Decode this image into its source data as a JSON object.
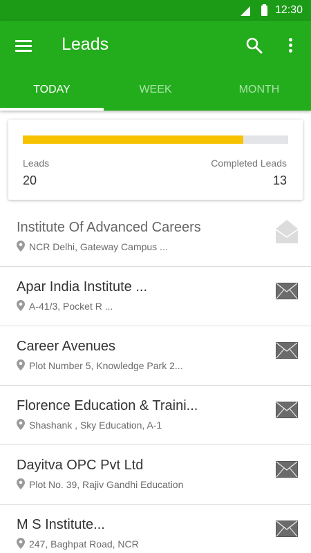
{
  "status_bar": {
    "time": "12:30",
    "signal_icon": "signal-icon",
    "battery_icon": "battery-icon"
  },
  "app_bar": {
    "title": "Leads",
    "menu_icon": "menu-icon",
    "search_icon": "search-icon",
    "more_icon": "more-vert-icon",
    "background": "#23ad1d",
    "status_background": "#1b9b16"
  },
  "tabs": [
    {
      "label": "TODAY",
      "active": true
    },
    {
      "label": "WEEK",
      "active": false
    },
    {
      "label": "MONTH",
      "active": false
    }
  ],
  "summary": {
    "leads_label": "Leads",
    "leads_value": "20",
    "completed_label": "Completed Leads",
    "completed_value": "13",
    "progress_fraction": 0.83,
    "progress_color": "#f7c300"
  },
  "leads": [
    {
      "name": "Institute Of Advanced Careers",
      "address": "NCR Delhi, Gateway Campus ...",
      "mail_state": "opened"
    },
    {
      "name": "Apar India Institute ...",
      "address": "A-41/3, Pocket R ...",
      "mail_state": "unread"
    },
    {
      "name": "Career Avenues",
      "address": "Plot Number 5, Knowledge Park 2...",
      "mail_state": "unread"
    },
    {
      "name": "Florence Education & Traini...",
      "address": "Shashank , Sky Education, A-1",
      "mail_state": "unread"
    },
    {
      "name": "Dayitva OPC Pvt Ltd",
      "address": "Plot No. 39, Rajiv Gandhi Education",
      "mail_state": "unread"
    },
    {
      "name": "M S Institute...",
      "address": "247, Baghpat Road, NCR",
      "mail_state": "unread"
    }
  ]
}
